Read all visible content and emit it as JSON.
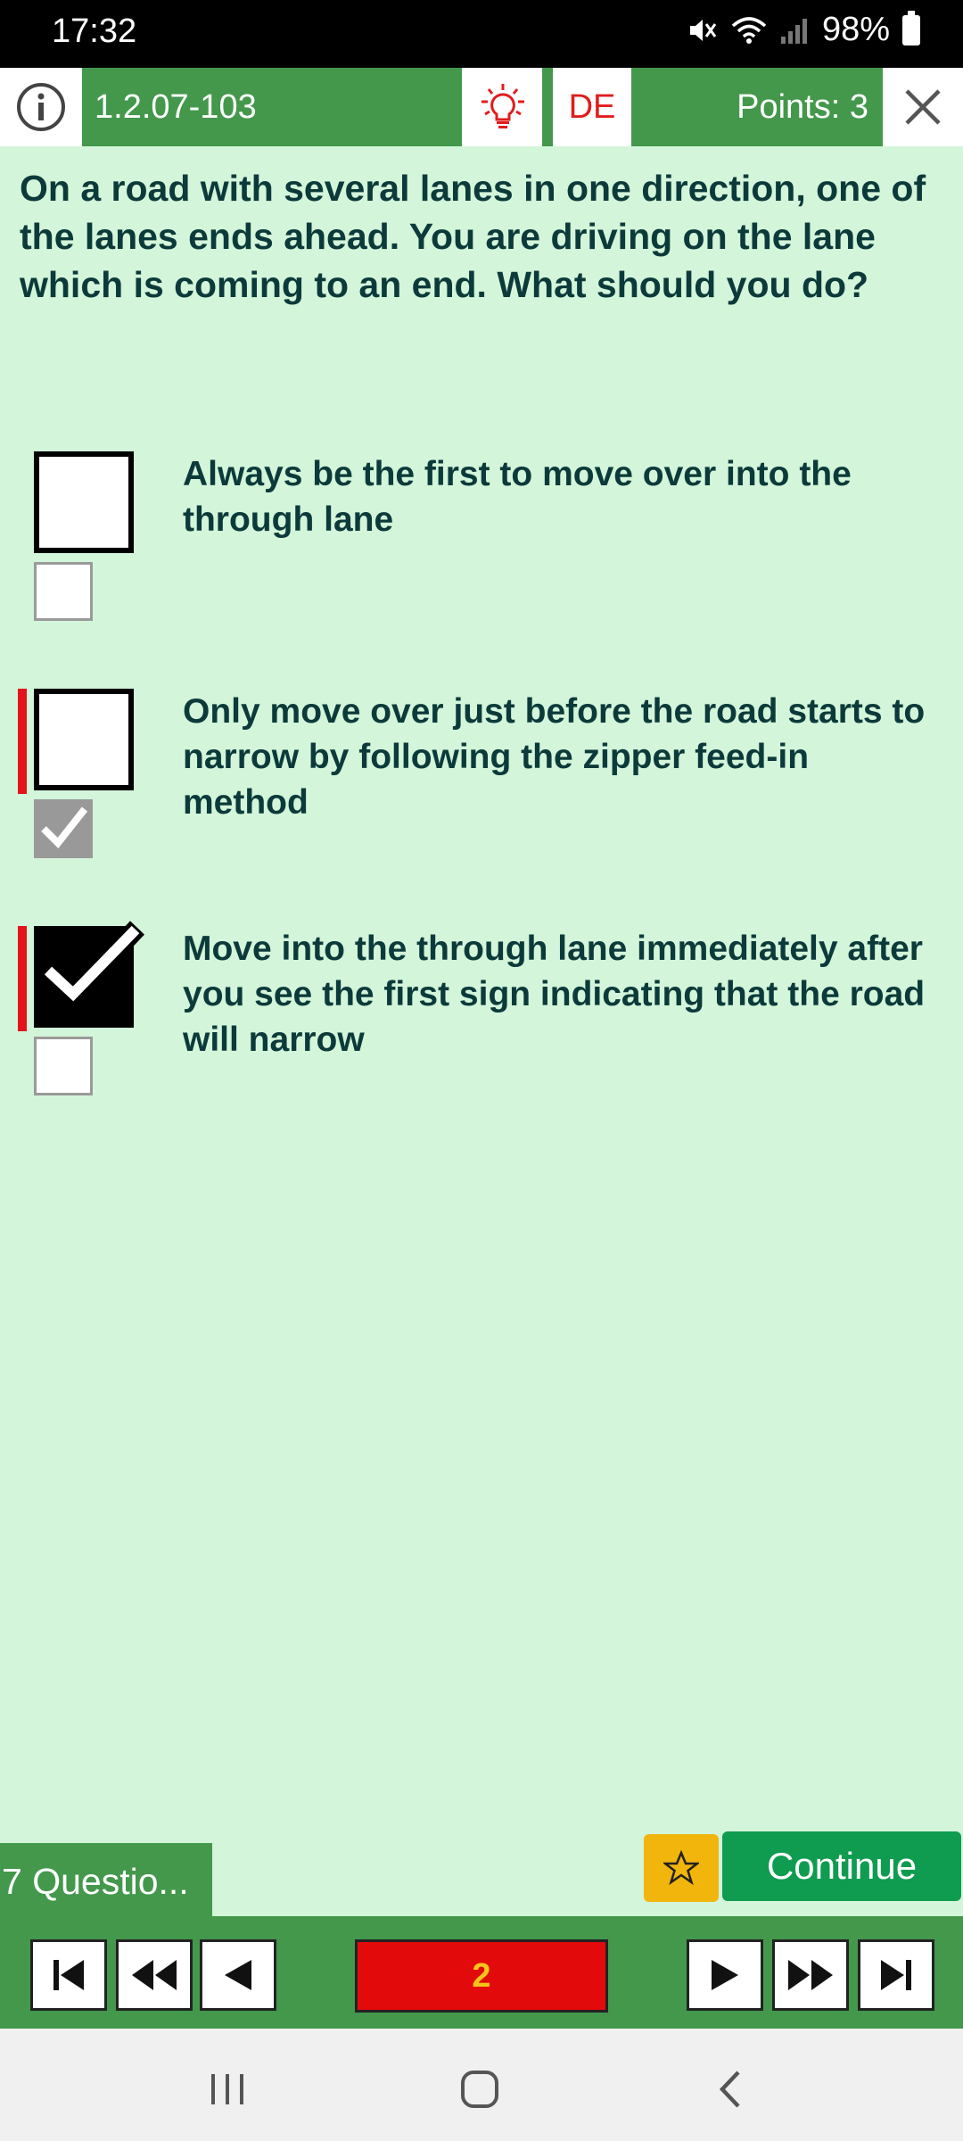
{
  "status_bar": {
    "time": "17:32",
    "battery_pct": "98%"
  },
  "header": {
    "question_code": "1.2.07-103",
    "language": "DE",
    "points": "Points: 3"
  },
  "question": {
    "text": "On a road with several lanes in one direction, one of the lanes ends ahead. You are driving on the lane which is coming to an end. What should you do?"
  },
  "answers": [
    {
      "text": "Always be the first to move over into the through lane",
      "user_checked": false,
      "solution_checked": false,
      "wrong_marker": false
    },
    {
      "text": "Only move over just before the road starts to narrow by following the zipper feed-in method",
      "user_checked": false,
      "solution_checked": true,
      "wrong_marker": true
    },
    {
      "text": "Move into the through lane immediately after you see the first sign indicating that the road will narrow",
      "user_checked": true,
      "solution_checked": false,
      "wrong_marker": true
    }
  ],
  "footer": {
    "questions_label": "7 Questio...",
    "continue_label": "Continue",
    "current_page": "2"
  },
  "colors": {
    "background": "#d3f5da",
    "header_green": "#43984c",
    "continue_green": "#0f9c50",
    "star_yellow": "#f1b50c",
    "wrong_red": "#e3141b",
    "page_red": "#e20a0a"
  },
  "icons": [
    "info-icon",
    "lightbulb-icon",
    "close-icon",
    "star-icon",
    "first-icon",
    "fast-back-icon",
    "back-icon",
    "forward-icon",
    "fast-forward-icon",
    "last-icon"
  ]
}
